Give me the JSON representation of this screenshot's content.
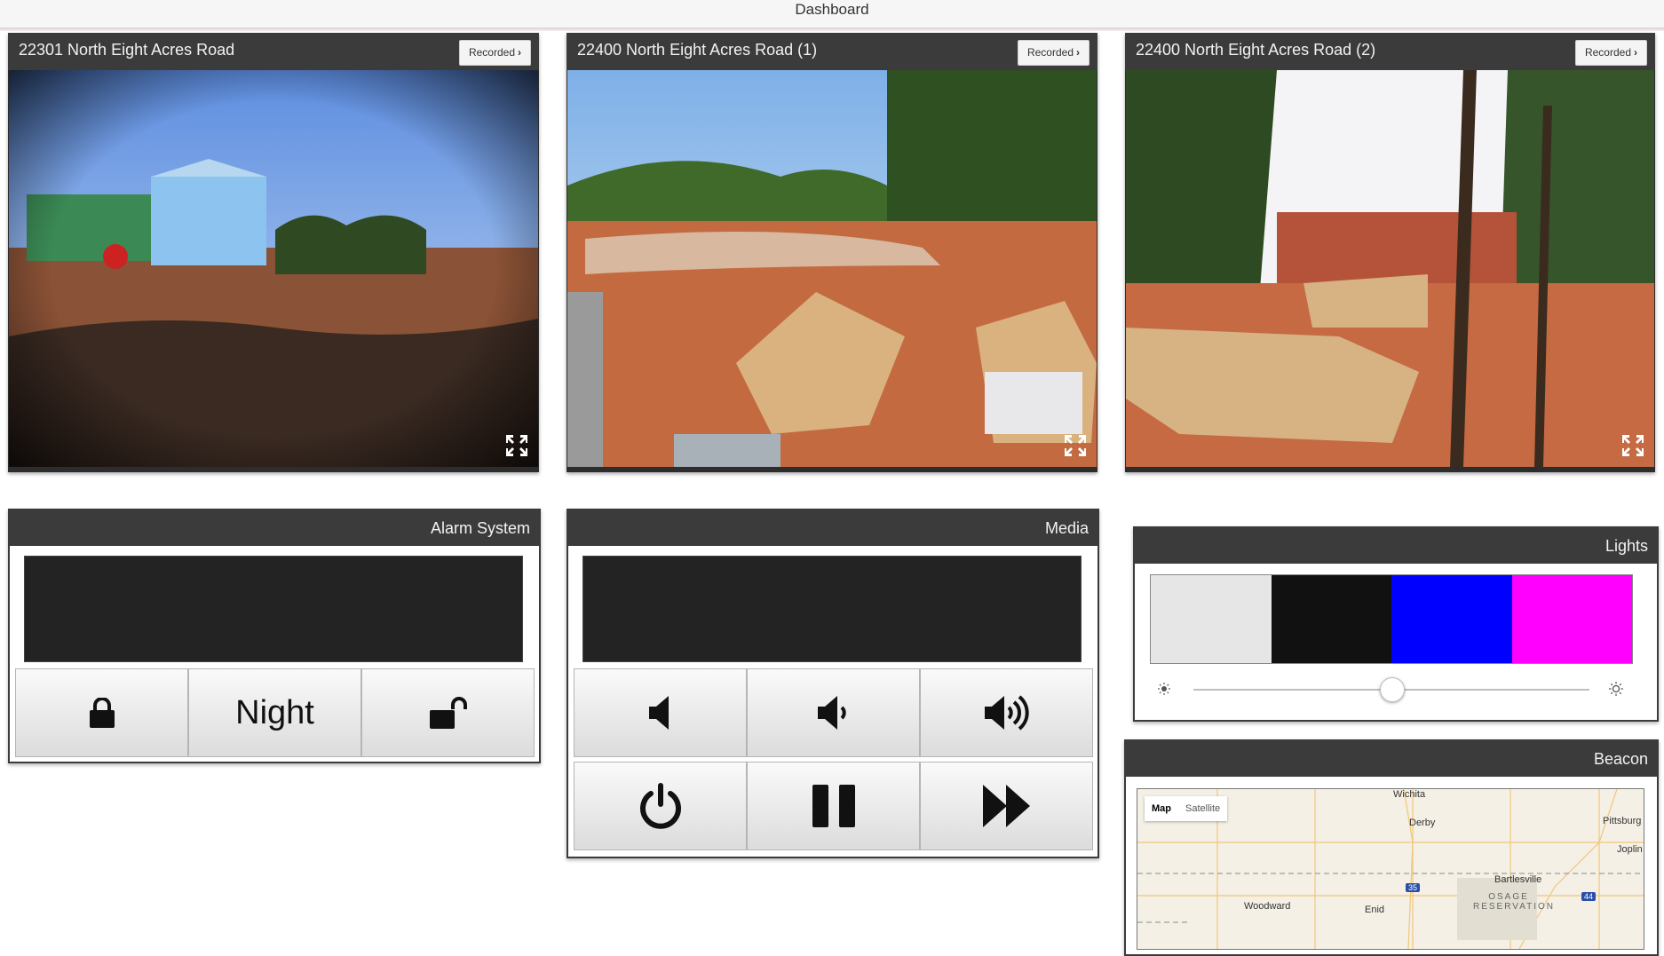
{
  "header": {
    "title": "Dashboard"
  },
  "cameras": [
    {
      "title": "22301 North Eight Acres Road",
      "recorded_label": "Recorded"
    },
    {
      "title": "22400 North Eight Acres Road (1)",
      "recorded_label": "Recorded"
    },
    {
      "title": "22400 North Eight Acres Road (2)",
      "recorded_label": "Recorded"
    }
  ],
  "alarm": {
    "title": "Alarm System",
    "display_text": "",
    "night_label": "Night"
  },
  "media": {
    "title": "Media",
    "display_text": ""
  },
  "lights": {
    "title": "Lights",
    "swatches": [
      "#e6e6e6",
      "#111111",
      "#0000ff",
      "#ff00ff"
    ],
    "brightness": 0.5
  },
  "beacon": {
    "title": "Beacon",
    "map_button": "Map",
    "satellite_button": "Satellite",
    "cities": [
      "Wichita",
      "Derby",
      "Pittsburg",
      "Joplin",
      "Bartlesville",
      "Woodward",
      "Enid",
      "OSAGE RESERVATION"
    ],
    "highways": [
      "35",
      "44"
    ]
  }
}
